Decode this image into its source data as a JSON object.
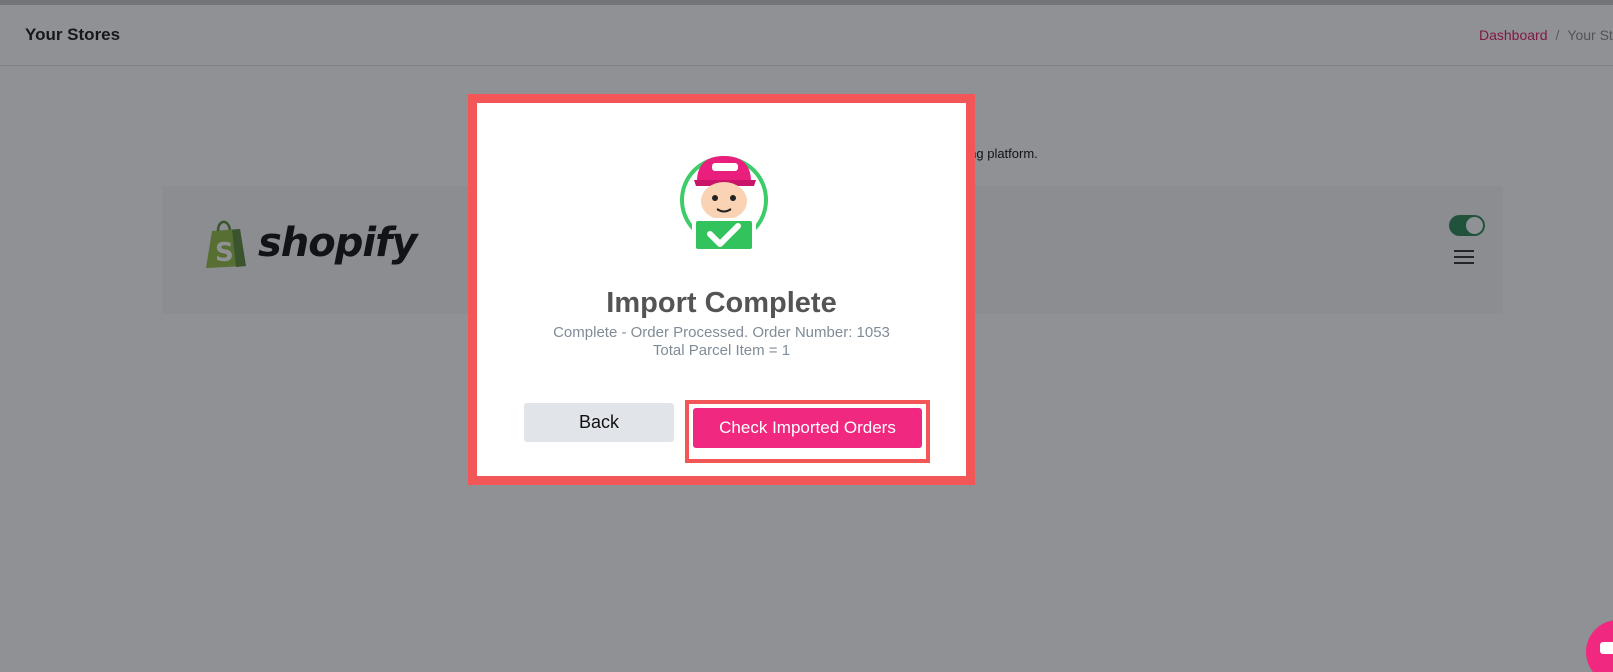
{
  "header": {
    "title": "Your Stores",
    "breadcrumb": {
      "link": "Dashboard",
      "separator": "/",
      "current": "Your St"
    }
  },
  "main": {
    "intro_text": "ur shipping platform.",
    "store": {
      "logo_text": "shopify",
      "logo_icon": "shopify-bag-icon",
      "toggle_enabled": true,
      "menu_icon": "hamburger-menu-icon"
    }
  },
  "modal": {
    "illustration_icon": "courier-checkmark-icon",
    "title": "Import Complete",
    "message_line1": "Complete - Order Processed. Order Number: 1053",
    "message_line2": "Total Parcel Item = 1",
    "back_label": "Back",
    "check_orders_label": "Check Imported Orders"
  },
  "chat": {
    "icon": "chat-icon"
  },
  "colors": {
    "accent": "#f0287f",
    "highlight": "#f25656",
    "toggle_on": "#2e8b57",
    "shopify_green": "#95bf47",
    "link": "#e01e6a"
  }
}
